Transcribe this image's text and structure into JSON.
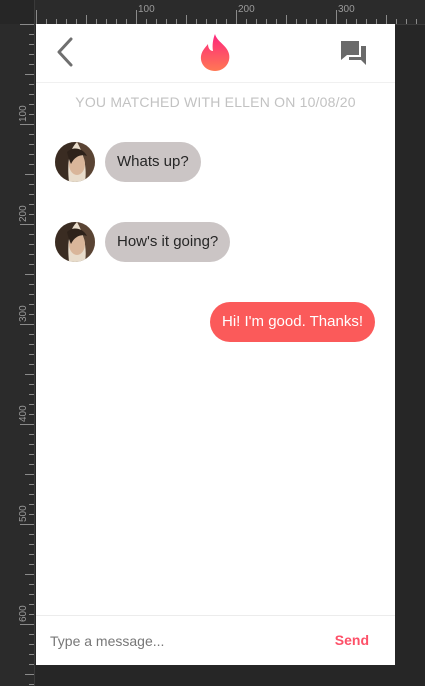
{
  "theme": {
    "brand_gradient_start": "#fd267d",
    "brand_gradient_end": "#ff7854",
    "incoming_bubble": "#cbc5c5",
    "outgoing_bubble": "#fb5a5a",
    "send_color": "#fd5068",
    "banner_color": "#c2c2c2"
  },
  "ruler": {
    "top_labels": [
      "100",
      "200",
      "300"
    ],
    "left_labels": [
      "100",
      "200",
      "300",
      "400",
      "500",
      "600"
    ]
  },
  "header": {
    "back_icon": "chevron-left-icon",
    "logo_icon": "flame-icon",
    "chat_icon": "chat-bubbles-icon"
  },
  "match_banner": "YOU MATCHED WITH ELLEN ON 10/08/20",
  "messages": [
    {
      "direction": "incoming",
      "text": "Whats up?"
    },
    {
      "direction": "incoming",
      "text": "How's it going?"
    },
    {
      "direction": "outgoing",
      "text": "Hi! I'm good. Thanks!"
    }
  ],
  "composer": {
    "placeholder": "Type a message...",
    "send_label": "Send"
  }
}
